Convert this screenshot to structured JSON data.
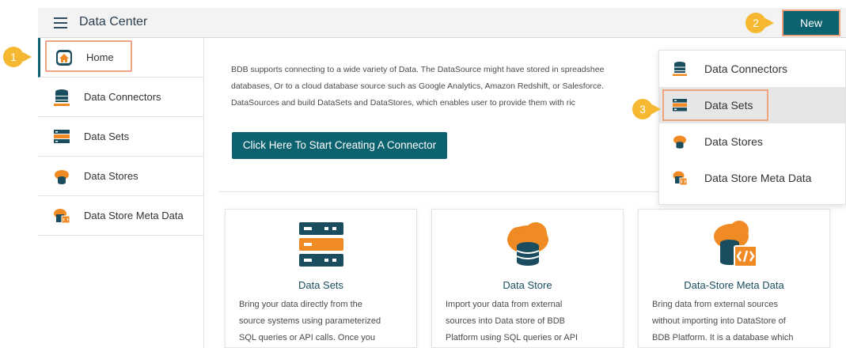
{
  "header": {
    "title": "Data Center",
    "new_label": "New"
  },
  "sidebar": {
    "items": [
      {
        "label": "Home",
        "icon": "home-icon"
      },
      {
        "label": "Data Connectors",
        "icon": "database-icon"
      },
      {
        "label": "Data Sets",
        "icon": "dataset-icon"
      },
      {
        "label": "Data Stores",
        "icon": "cloud-database-icon"
      },
      {
        "label": "Data Store Meta Data",
        "icon": "meta-data-icon"
      }
    ]
  },
  "main": {
    "intro_line1": "BDB supports connecting to a wide variety of Data. The DataSource might have stored in spreadshee",
    "intro_line2": "databases, Or to a cloud database source such as Google Analytics, Amazon Redshift, or Salesforce. ",
    "intro_line3": "DataSources and build DataSets and DataStores, which enables user to provide them with ric",
    "cta_label": "Click Here To Start Creating A Connector",
    "cards": [
      {
        "title": "Data Sets",
        "desc1": "Bring your data directly from the",
        "desc2": "source systems using parameterized",
        "desc3": "SQL queries or API calls. Once you"
      },
      {
        "title": "Data Store",
        "desc1": "Import your data from external",
        "desc2": "sources into Data store of BDB",
        "desc3": "Platform using SQL queries or API"
      },
      {
        "title": "Data-Store Meta Data",
        "desc1": "Bring data from external sources",
        "desc2": "without importing into DataStore of",
        "desc3": "BDB Platform. It is a database which"
      }
    ]
  },
  "dropdown": {
    "items": [
      {
        "label": "Data Connectors",
        "icon": "database-icon"
      },
      {
        "label": "Data Sets",
        "icon": "dataset-icon"
      },
      {
        "label": "Data Stores",
        "icon": "cloud-database-icon"
      },
      {
        "label": "Data Store Meta Data",
        "icon": "meta-data-icon"
      }
    ]
  },
  "badges": {
    "one": "1",
    "two": "2",
    "three": "3"
  },
  "colors": {
    "accent": "#0d6270",
    "highlight_border": "#f0a37f",
    "badge": "#f6b731",
    "icon_orange": "#f08a24",
    "icon_navy": "#1b4d60"
  }
}
